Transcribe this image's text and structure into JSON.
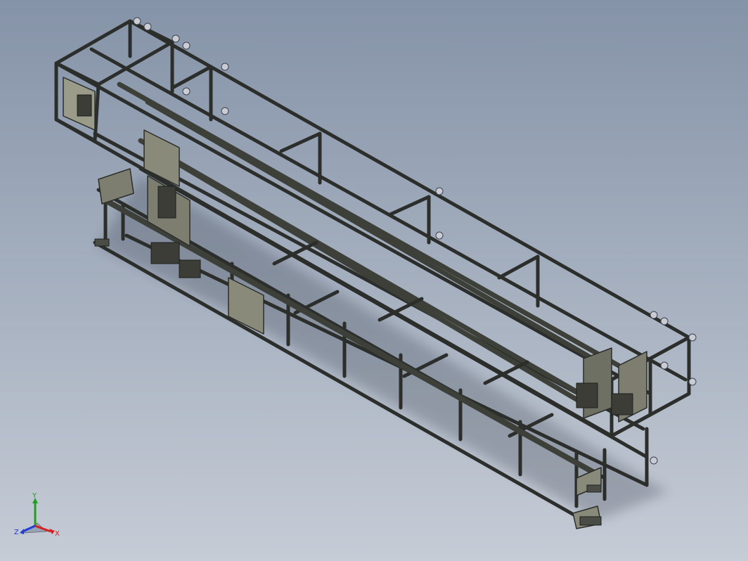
{
  "viewport": {
    "background_top": "#8593a8",
    "background_bottom": "#c6ccd6",
    "frame_color": "#2b2e2a",
    "frame_highlight": "#6e7366",
    "plate_color": "#8a8a7a",
    "rail_color": "#3d4038",
    "bolt_color": "#c9ccd2"
  },
  "triad": {
    "x_label": "X",
    "y_label": "Y",
    "z_label": "Z",
    "x_color": "#d62020",
    "y_color": "#1fa01f",
    "z_color": "#1f3fd6"
  }
}
